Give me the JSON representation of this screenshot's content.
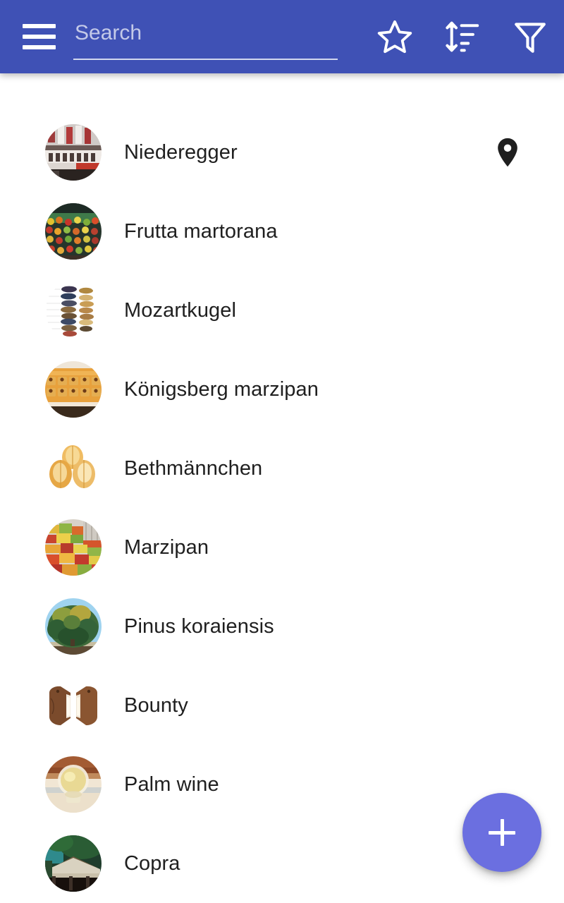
{
  "app": {
    "accent_color": "#3f51b5",
    "fab_color": "#6b6fe0",
    "background_color": "#ffffff",
    "text_color": "#1f1f1f"
  },
  "toolbar": {
    "menu_icon": "hamburger-menu-icon",
    "search": {
      "placeholder": "Search",
      "value": ""
    },
    "actions": [
      {
        "name": "star-icon",
        "label": "Favorites"
      },
      {
        "name": "sort-icon",
        "label": "Sort"
      },
      {
        "name": "filter-icon",
        "label": "Filter"
      }
    ]
  },
  "list": {
    "items": [
      {
        "title": "Niederegger",
        "thumb": "shop-facade-photo",
        "has_location_pin": true
      },
      {
        "title": "Frutta martorana",
        "thumb": "fruit-market-photo",
        "has_location_pin": false
      },
      {
        "title": "Mozartkugel",
        "thumb": "chocolate-balls-photo",
        "has_location_pin": false
      },
      {
        "title": "Königsberg marzipan",
        "thumb": "marzipan-cake-photo",
        "has_location_pin": false
      },
      {
        "title": "Bethmännchen",
        "thumb": "pastry-trio-photo",
        "has_location_pin": false
      },
      {
        "title": "Marzipan",
        "thumb": "market-stall-photo",
        "has_location_pin": false
      },
      {
        "title": "Pinus koraiensis",
        "thumb": "pine-tree-photo",
        "has_location_pin": false
      },
      {
        "title": "Bounty",
        "thumb": "chocolate-bar-photo",
        "has_location_pin": false
      },
      {
        "title": "Palm wine",
        "thumb": "glass-of-wine-photo",
        "has_location_pin": false
      },
      {
        "title": "Copra",
        "thumb": "drying-hut-photo",
        "has_location_pin": false
      }
    ],
    "location_pin_icon": "location-pin-icon"
  },
  "fab": {
    "icon": "plus-icon",
    "label": "Add"
  }
}
